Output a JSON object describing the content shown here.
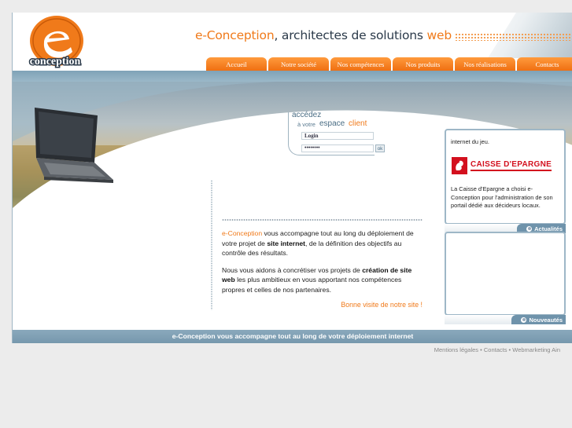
{
  "header": {
    "logo_text": "conception",
    "tagline_brand": "e-Conception",
    "tagline_middle": ", architectes de solutions ",
    "tagline_web": "web"
  },
  "nav": {
    "tabs": [
      {
        "label": "Accueil"
      },
      {
        "label": "Notre société"
      },
      {
        "label": "Nos compétences"
      },
      {
        "label": "Nos produits"
      },
      {
        "label": "Nos réalisations"
      },
      {
        "label": "Contacts"
      }
    ]
  },
  "login": {
    "line1": "accédez",
    "line2": "à votre",
    "line3": "espace",
    "line4": "client",
    "login_value": "Login",
    "password_value": "••••••••",
    "ok_label": "ok"
  },
  "content": {
    "p1_brand": "e-Conception",
    "p1_a": " vous accompagne tout au long du déploiement de votre projet de ",
    "p1_b": "site internet",
    "p1_c": ", de la définition des objectifs au contrôle des résultats.",
    "p2_a": "Nous vous aidons à concrétiser vos projets de ",
    "p2_b": "création de site web",
    "p2_c": " les plus ambitieux en vous apportant nos compétences propres et celles de nos partenaires.",
    "visit": "Bonne visite de notre site !"
  },
  "news": {
    "top_text": "internet du jeu.",
    "logo_text": "CAISSE D'EPARGNE",
    "body": "La Caisse d'Epargne a choisi e-Conception pour l'administration de son portail dédié aux décideurs locaux.",
    "badge": "Actualités"
  },
  "updates": {
    "badge": "Nouveautés"
  },
  "bottombar": {
    "text": "e-Conception vous accompagne tout au long de votre déploiement internet"
  },
  "footer": {
    "link1": "Mentions légales",
    "sep": " • ",
    "link2": "Contacts",
    "link3": "Webmarketing Ain"
  },
  "colors": {
    "accent": "#f07a1a",
    "frame_blue": "#7698ad"
  }
}
